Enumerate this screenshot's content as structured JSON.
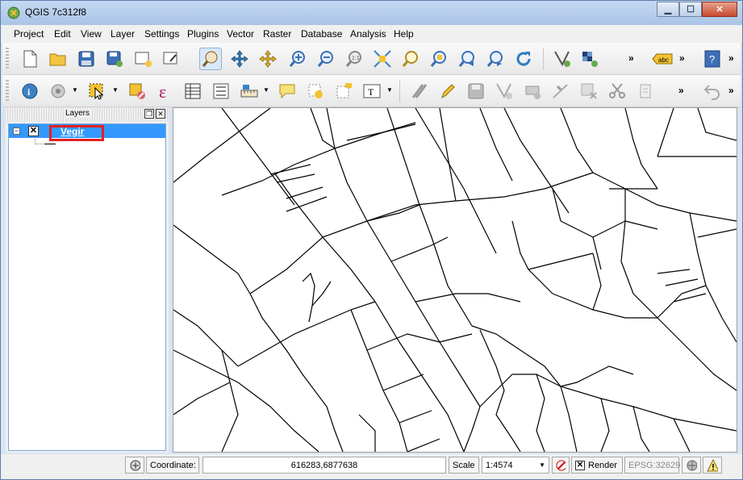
{
  "window": {
    "title": "QGIS 7c312f8",
    "minimize": "▁",
    "maximize": "☐",
    "close": "✕"
  },
  "menu": [
    {
      "label": "Project"
    },
    {
      "label": "Edit"
    },
    {
      "label": "View"
    },
    {
      "label": "Layer"
    },
    {
      "label": "Settings"
    },
    {
      "label": "Plugins"
    },
    {
      "label": "Vector"
    },
    {
      "label": "Raster"
    },
    {
      "label": "Database"
    },
    {
      "label": "Analysis"
    },
    {
      "label": "Help"
    }
  ],
  "toolbar1": {
    "icons": [
      "new-project-icon",
      "open-project-icon",
      "save-project-icon",
      "save-as-icon",
      "new-print-composer-icon",
      "composer-manager-icon",
      "pan-icon",
      "pan-to-selection-icon",
      "zoom-to-selection-icon",
      "zoom-in-icon",
      "zoom-out-icon",
      "zoom-actual-size-icon",
      "zoom-full-icon",
      "zoom-to-layer-icon",
      "zoom-to-selection2-icon",
      "zoom-last-icon",
      "zoom-next-icon",
      "refresh-icon",
      "digitize-node-icon",
      "add-raster-icon",
      "label-icon",
      "help-icon"
    ],
    "more": "»",
    "label_badge": "abc"
  },
  "toolbar2": {
    "icons": [
      "identify-icon",
      "run-action-icon",
      "select-icon",
      "deselect-icon",
      "expression-select-icon",
      "attribute-table-icon",
      "measure-icon",
      "measure-tool-icon",
      "map-tips-icon",
      "new-bookmark-icon",
      "show-bookmarks-icon",
      "text-annotation-icon",
      "current-edits-icon",
      "toggle-editing-icon",
      "save-edits-icon",
      "add-feature-icon",
      "move-feature-icon",
      "node-tool-icon",
      "delete-selected-icon",
      "cut-features-icon",
      "copy-features-icon",
      "undo-icon"
    ],
    "more": "»"
  },
  "layers_panel": {
    "title": "Layers",
    "float_button": "❐",
    "close_button": "✕",
    "layers": [
      {
        "name": "Vegir",
        "visible": true,
        "expanded": true
      }
    ]
  },
  "statusbar": {
    "coordinate_label": "Coordinate:",
    "coordinate_value": "616283,6877638",
    "scale_label": "Scale",
    "scale_value": "1:4574",
    "render_label": "Render",
    "render_checked": true,
    "crs": "EPSG:32629"
  },
  "colors": {
    "selection": "#3399ff",
    "highlight": "#e02020",
    "titlebar": "#b8cfeb"
  }
}
